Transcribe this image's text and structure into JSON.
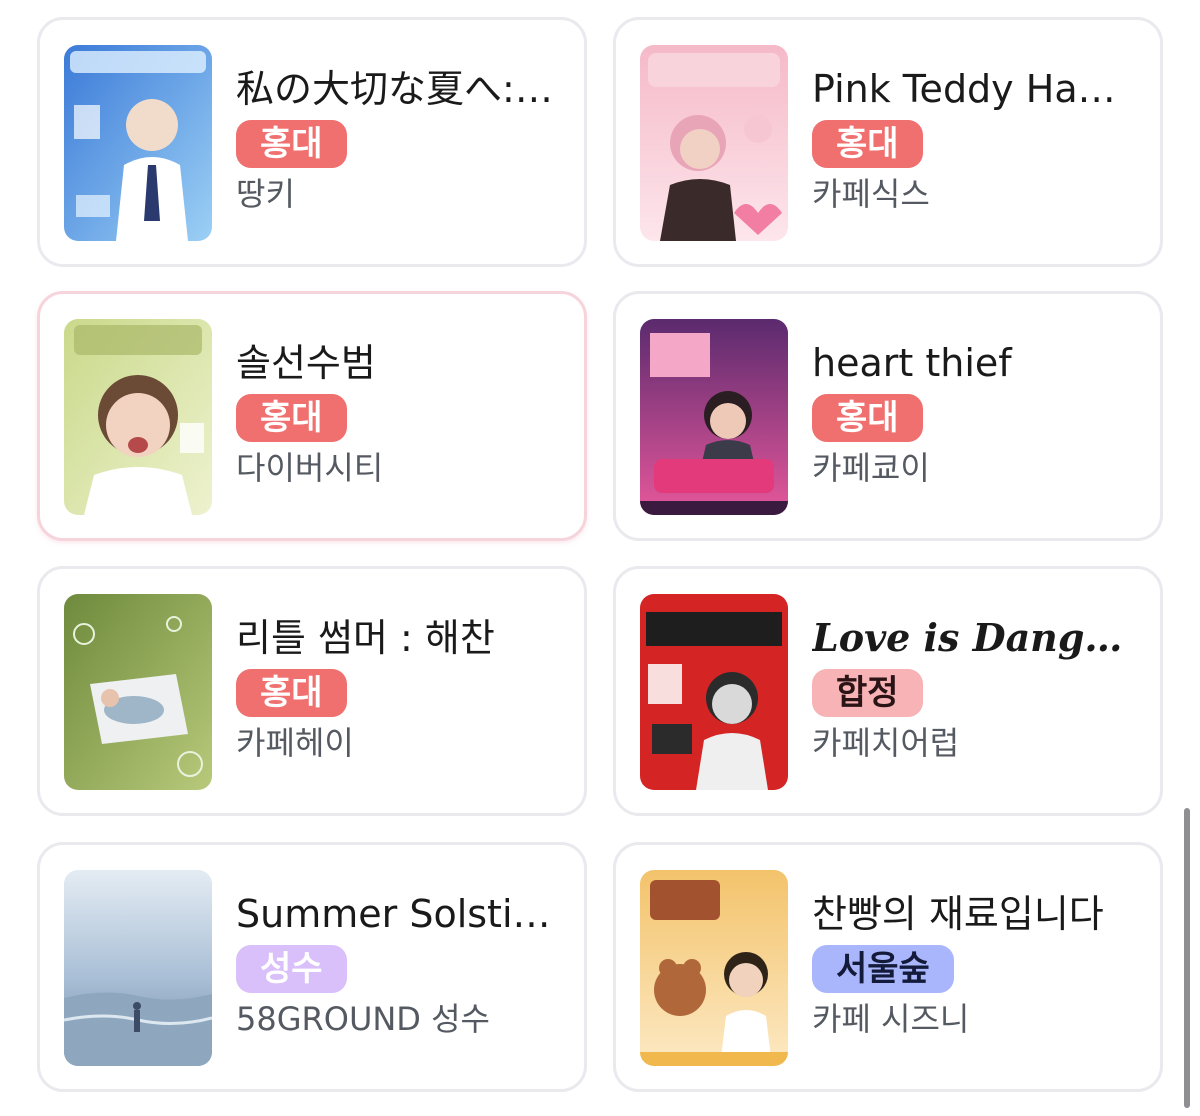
{
  "cards": [
    {
      "title": "私の大切な夏へ: …",
      "badge": "홍대",
      "venue": "땅키",
      "poster_colors": [
        "#3b7ad8",
        "#9cd0f5"
      ]
    },
    {
      "title": "Pink Teddy Hae…",
      "badge": "홍대",
      "venue": "카페식스",
      "poster_colors": [
        "#f5b9c8",
        "#fde6ec"
      ]
    },
    {
      "title": "솔선수범",
      "badge": "홍대",
      "venue": "다이버시티",
      "poster_colors": [
        "#c9d98a",
        "#eef2cf"
      ]
    },
    {
      "title": "heart thief",
      "badge": "홍대",
      "venue": "카페쿄이",
      "poster_colors": [
        "#5b2a6e",
        "#e6589b"
      ]
    },
    {
      "title": "리틀 썸머 : 해찬",
      "badge": "홍대",
      "venue": "카페헤이",
      "poster_colors": [
        "#6e8a3c",
        "#b8c97a"
      ]
    },
    {
      "title": "Love is Danger…",
      "badge": "합정",
      "venue": "카페치어럽",
      "poster_colors": [
        "#d42424",
        "#2b2b2b"
      ]
    },
    {
      "title": "Summer Solstic…",
      "badge": "성수",
      "venue": "58GROUND 성수",
      "poster_colors": [
        "#a9bfd6",
        "#e4ecf3"
      ]
    },
    {
      "title": "찬빵의 재료입니다",
      "badge": "서울숲",
      "venue": "카페 시즈니",
      "poster_colors": [
        "#f3c36b",
        "#fde9c4"
      ]
    }
  ],
  "badge_colors": {
    "홍대": "#f07070",
    "합정": "#f8b3b6",
    "성수": "#d9c0fa",
    "서울숲": "#aab6fb"
  }
}
